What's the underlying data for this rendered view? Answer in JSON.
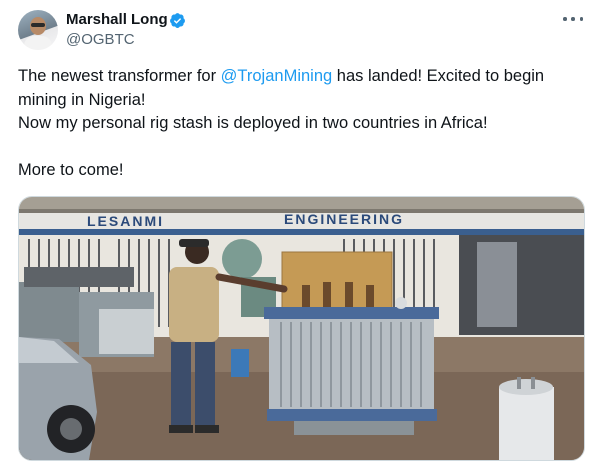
{
  "author": {
    "display_name": "Marshall Long",
    "handle": "@OGBTC",
    "verified": true
  },
  "tweet": {
    "line1_before": "The newest transformer for ",
    "mention": "@TrojanMining",
    "line1_after": " has landed! Excited to begin mining in Nigeria!",
    "line2": "Now my personal rig stash is deployed in two countries in Africa!",
    "line3": "More to come!"
  },
  "media": {
    "sign_left": "LESANMI",
    "sign_right": "ENGINEERING"
  },
  "icons": {
    "verified": "verified-badge-icon",
    "more": "more-options-icon"
  },
  "colors": {
    "accent": "#1d9bf0",
    "text": "#0f1419",
    "secondary": "#536471"
  }
}
